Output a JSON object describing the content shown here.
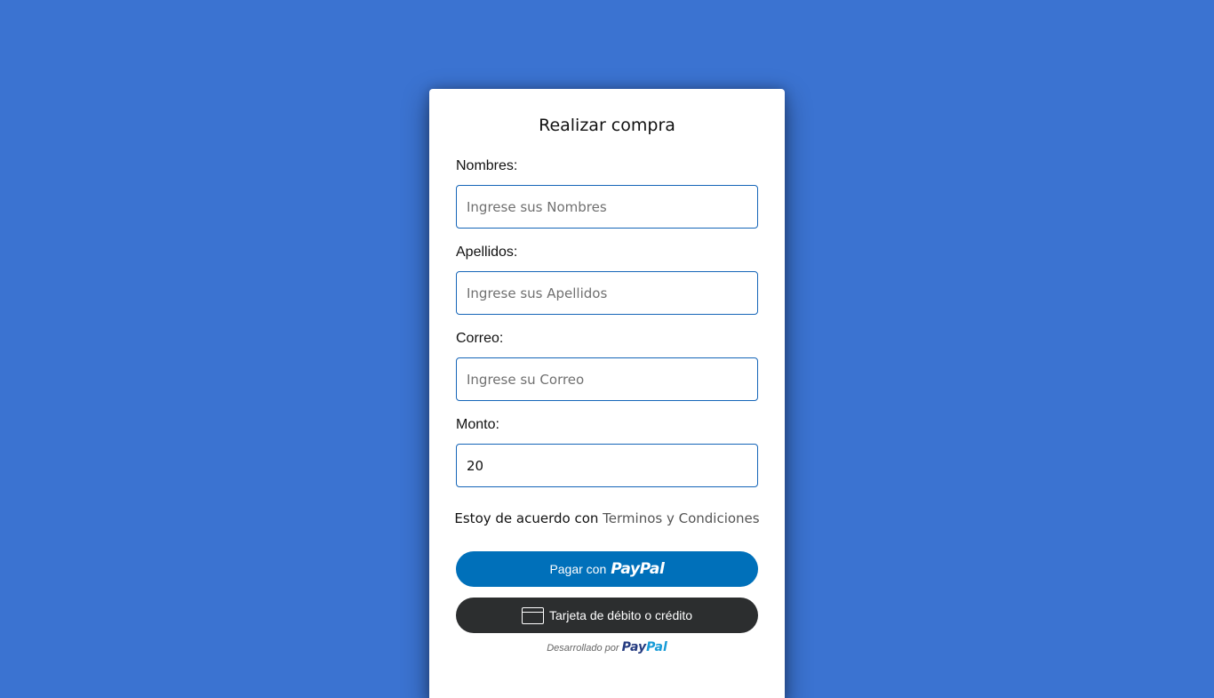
{
  "form": {
    "title": "Realizar compra",
    "fields": [
      {
        "label": "Nombres:",
        "placeholder": "Ingrese sus Nombres",
        "value": ""
      },
      {
        "label": "Apellidos:",
        "placeholder": "Ingrese sus Apellidos",
        "value": ""
      },
      {
        "label": "Correo:",
        "placeholder": "Ingrese su Correo",
        "value": ""
      },
      {
        "label": "Monto:",
        "placeholder": "",
        "value": "20"
      }
    ],
    "terms_prefix": "Estoy de acuerdo con",
    "terms_link": "Terminos y Condiciones"
  },
  "payment": {
    "paypal_prefix": "Pagar con",
    "paypal_brand": "PayPal",
    "card_label": "Tarjeta de débito o crédito",
    "powered_prefix": "Desarrollado por",
    "powered_brand_1": "Pay",
    "powered_brand_2": "Pal"
  },
  "colors": {
    "background": "#3b73d1",
    "input_border": "#1565b8",
    "paypal_button": "#0070ba",
    "card_button": "#2c2e2f"
  },
  "icons": [
    "credit-card-icon"
  ]
}
